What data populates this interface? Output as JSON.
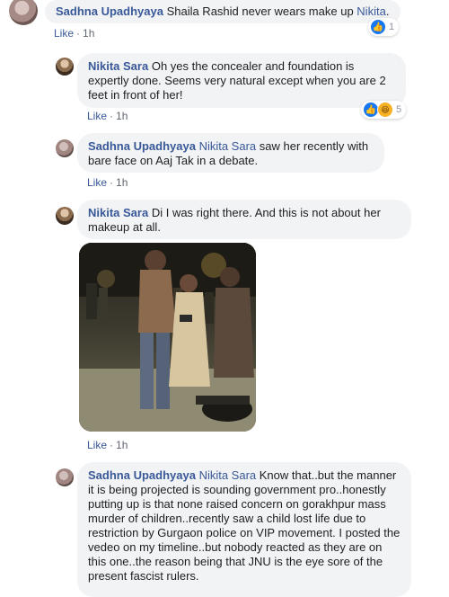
{
  "comments": [
    {
      "author": "Sadhna Upadhyaya",
      "text": "Shaila Rashid never wears make up",
      "mention_after": "Nikita",
      "suffix": ".",
      "like_label": "Like",
      "time": "1h",
      "reaction_count": "1",
      "reactions": [
        "like"
      ]
    },
    {
      "author": "Nikita Sara",
      "text": "Oh yes the concealer and foundation is expertly done. Seems very natural except when you are 2 feet in front of her!",
      "like_label": "Like",
      "time": "1h",
      "reaction_count": "5",
      "reactions": [
        "like",
        "haha"
      ]
    },
    {
      "author": "Sadhna Upadhyaya",
      "mention": "Nikita Sara",
      "text": "saw her recently with bare face on Aaj Tak in a debate.",
      "like_label": "Like",
      "time": "1h"
    },
    {
      "author": "Nikita Sara",
      "text": "Di I was right there. And this is not about her makeup at all.",
      "like_label": "Like",
      "time": "1h"
    },
    {
      "author": "Sadhna Upadhyaya",
      "mention": "Nikita Sara",
      "text": "Know that..but the manner it is being projected is sounding government pro..honestly putting up is that none raised concern on gorakhpur mass murder of children..recently saw a child lost life due to restriction by Gurgaon police on VIP movement. I posted the vedeo on my timeline..but nobody reacted as they are on this one..the reason being that JNU is the eye sore of the present fascist rulers."
    }
  ],
  "separator": "·",
  "colors": {
    "link": "#385898",
    "bubble": "#f2f3f5",
    "meta": "#606770",
    "like_reaction": "#1877f2",
    "haha_reaction": "#f7b125"
  },
  "icons": {
    "like": "thumbs-up-icon",
    "haha": "laughing-face-icon"
  }
}
